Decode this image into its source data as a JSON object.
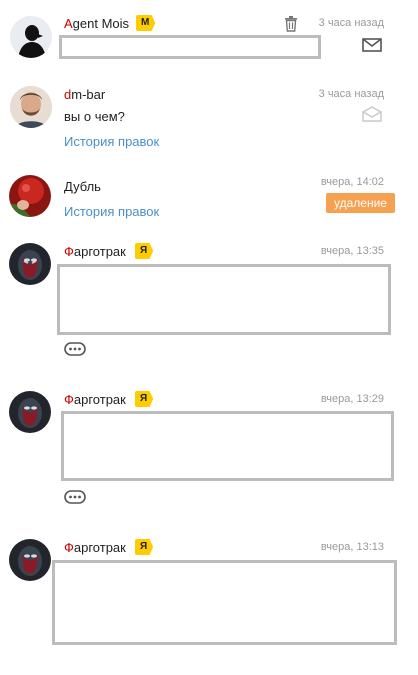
{
  "comments": [
    {
      "author_first": "A",
      "author_rest": "gent Mois",
      "badge": "М",
      "time": "3 часа назад",
      "icons": [
        "trash-icon",
        "envelope-icon"
      ]
    },
    {
      "author_first": "d",
      "author_rest": "m-bar",
      "time": "3 часа назад",
      "text": "вы о чем?",
      "history": "История правок",
      "icons": [
        "envelope-open-icon"
      ]
    },
    {
      "author": "Дубль",
      "time": "вчера, 14:02",
      "history": "История правок",
      "delete_label": "удаление"
    },
    {
      "author_first": "Ф",
      "author_rest": "арготрак",
      "badge": "Я",
      "time": "вчера, 13:35",
      "icons": [
        "more-icon"
      ]
    },
    {
      "author_first": "Ф",
      "author_rest": "арготрак",
      "badge": "Я",
      "time": "вчера, 13:29",
      "icons": [
        "more-icon"
      ]
    },
    {
      "author_first": "Ф",
      "author_rest": "арготрак",
      "badge": "Я",
      "time": "вчера, 13:13"
    }
  ],
  "colors": {
    "accent_red": "#cc0000",
    "link_blue": "#4a90c9",
    "badge_yellow": "#ffcc00",
    "delete_orange": "#f6a052",
    "redaction_gray": "#bcbcbc"
  }
}
